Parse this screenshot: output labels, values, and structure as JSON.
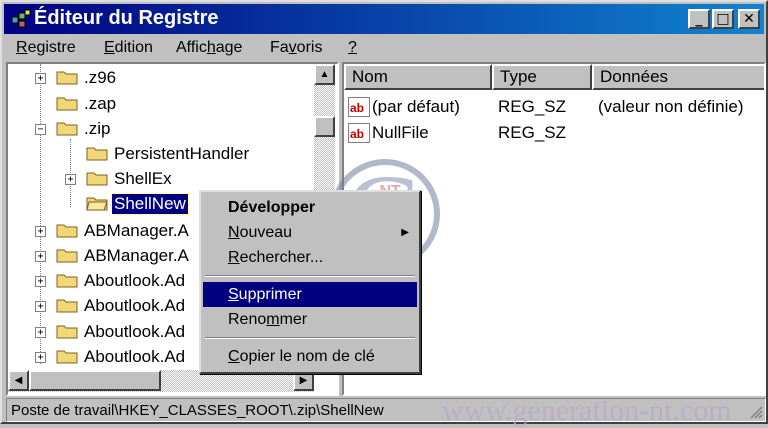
{
  "window": {
    "title": "Éditeur du Registre",
    "controls": {
      "minimize": "_",
      "maximize": "□",
      "close": "✕"
    }
  },
  "menubar": {
    "items": [
      {
        "pre": "",
        "u": "R",
        "post": "egistre"
      },
      {
        "pre": "",
        "u": "E",
        "post": "dition"
      },
      {
        "pre": "Affic",
        "u": "h",
        "post": "age"
      },
      {
        "pre": "Fa",
        "u": "v",
        "post": "oris"
      },
      {
        "pre": "",
        "u": "?",
        "post": ""
      }
    ]
  },
  "tree": {
    "items": [
      {
        "label": ".z96",
        "expander": "+"
      },
      {
        "label": ".zap",
        "expander": ""
      },
      {
        "label": ".zip",
        "expander": "−"
      },
      {
        "label": "PersistentHandler",
        "expander": ""
      },
      {
        "label": "ShellEx",
        "expander": "+"
      },
      {
        "label": "ShellNew",
        "expander": "",
        "selected": true
      },
      {
        "label": "ABManager.A",
        "expander": "+"
      },
      {
        "label": "ABManager.A",
        "expander": "+"
      },
      {
        "label": "Aboutlook.Ad",
        "expander": "+"
      },
      {
        "label": "Aboutlook.Ad",
        "expander": "+"
      },
      {
        "label": "Aboutlook.Ad",
        "expander": "+"
      },
      {
        "label": "Aboutlook.Ad",
        "expander": "+"
      }
    ]
  },
  "list": {
    "columns": [
      "Nom",
      "Type",
      "Données"
    ],
    "rows": [
      {
        "name": "(par défaut)",
        "type": "REG_SZ",
        "data": "(valeur non définie)"
      },
      {
        "name": "NullFile",
        "type": "REG_SZ",
        "data": ""
      }
    ]
  },
  "context_menu": {
    "expand": "Développer",
    "new": {
      "u": "N",
      "post": "ouveau"
    },
    "find": {
      "u": "R",
      "post": "echercher..."
    },
    "delete": {
      "u": "S",
      "post": "upprimer"
    },
    "rename": {
      "pre": "Reno",
      "u": "m",
      "post": "mer"
    },
    "copy_key": {
      "u": "C",
      "post": "opier le nom de clé"
    }
  },
  "status": {
    "path": "Poste de travail\\HKEY_CLASSES_ROOT\\.zip\\ShellNew"
  },
  "watermark": {
    "url": "www.generation-nt.com",
    "logo_letter": "G",
    "logo_tag": "NT"
  },
  "colors": {
    "selection": "#000080",
    "title_start": "#000080",
    "title_end": "#1084d0",
    "folder": "#f0d878"
  }
}
